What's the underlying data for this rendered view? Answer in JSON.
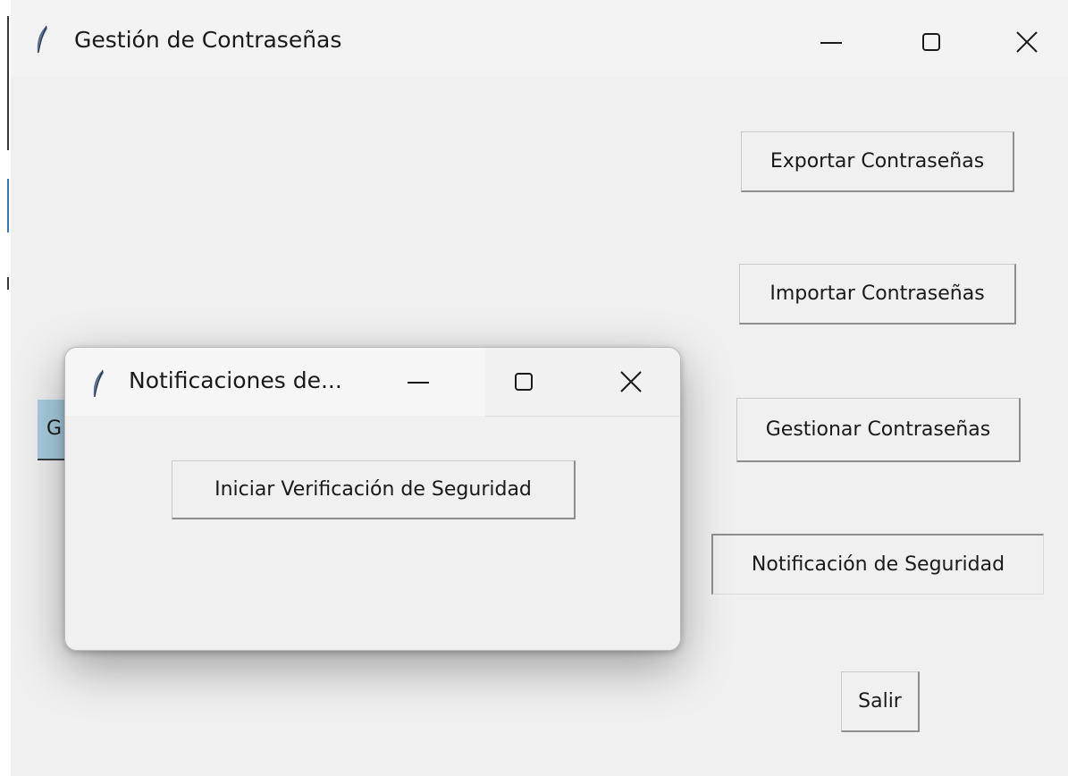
{
  "main_window": {
    "title": "Gestión de Contraseñas",
    "title_icon": "feather-icon",
    "controls": {
      "minimize_icon": "minimize-icon",
      "maximize_icon": "maximize-icon",
      "close_icon": "close-icon"
    },
    "buttons": {
      "export": "Exportar Contraseñas",
      "import": "Importar Contraseñas",
      "manage": "Gestionar Contraseñas",
      "notification": "Notificación de Seguridad",
      "exit": "Salir"
    },
    "partial_button_label": "G"
  },
  "dialog": {
    "title": "Notificaciones de...",
    "title_icon": "feather-icon",
    "controls": {
      "minimize_icon": "minimize-icon",
      "maximize_icon": "maximize-icon",
      "close_icon": "close-icon"
    },
    "buttons": {
      "start_check": "Iniciar Verificación de Seguridad"
    }
  },
  "colors": {
    "window_bg": "#f0f0f0",
    "titlebar_bg": "#f3f3f3",
    "partial_button_bg": "#a9cfe0",
    "text": "#1a1a1a"
  }
}
